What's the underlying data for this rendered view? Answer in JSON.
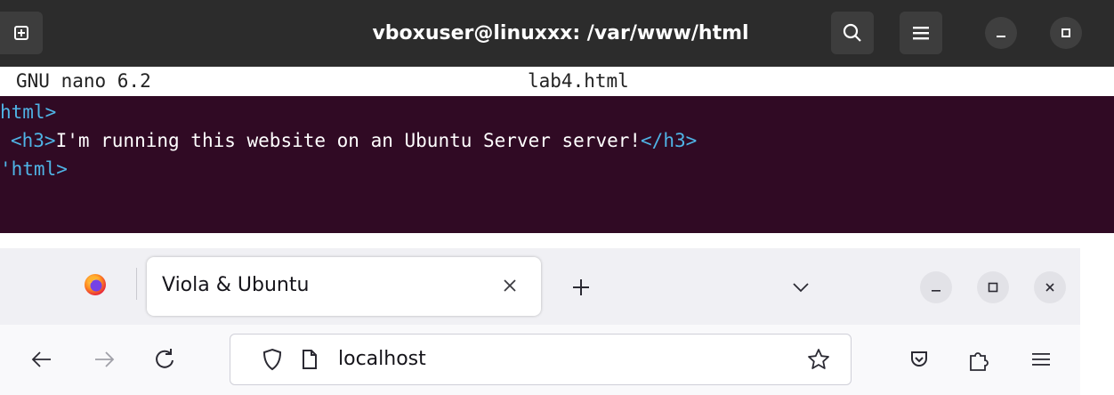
{
  "terminal": {
    "title": "vboxuser@linuxxx: /var/www/html",
    "icons": [
      "new-tab-icon",
      "search-icon",
      "hamburger-menu-icon",
      "minimize-icon",
      "restore-icon"
    ],
    "nano": {
      "version": "GNU nano 6.2",
      "filename": "lab4.html"
    },
    "lines": [
      {
        "tag_open": "html>",
        "text": "",
        "tag_close": ""
      },
      {
        "tag_open": "<h3>",
        "text": "I'm running this website on an Ubuntu Server server!",
        "tag_close": "</h3>"
      },
      {
        "tag_open": "'html>",
        "text": "",
        "tag_close": ""
      }
    ],
    "colors": {
      "background": "#300a24",
      "header": "#2c2c2c",
      "tag": "#4fb4e6"
    }
  },
  "browser": {
    "tab": {
      "title": "Viola & Ubuntu"
    },
    "url": "localhost",
    "icons": [
      "firefox-logo-icon",
      "close-icon",
      "plus-icon",
      "chevron-down-icon",
      "minimize-icon",
      "maximize-icon",
      "close-window-icon",
      "back-arrow-icon",
      "forward-arrow-icon",
      "reload-icon",
      "shield-icon",
      "page-icon",
      "star-icon",
      "pocket-icon",
      "extensions-icon",
      "menu-icon"
    ]
  }
}
